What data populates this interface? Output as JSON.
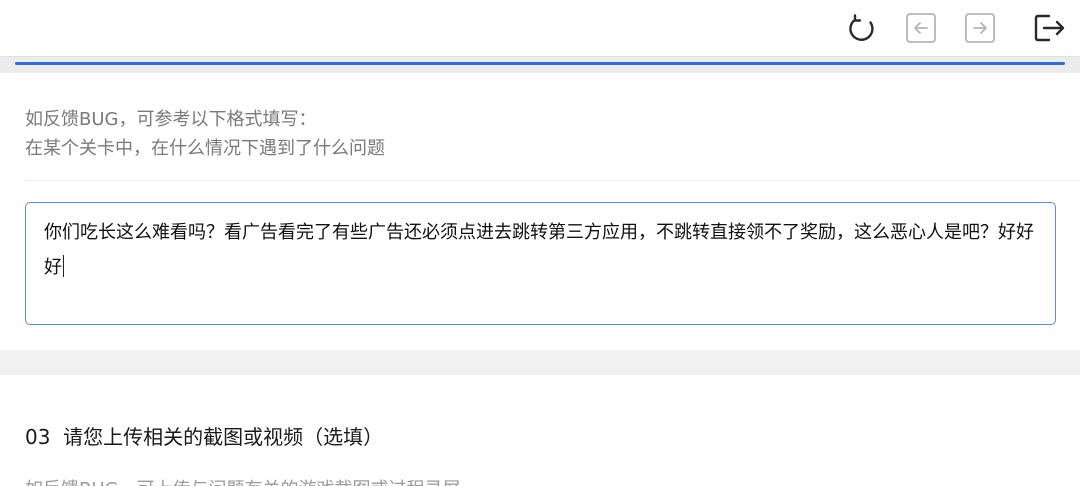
{
  "toolbar": {
    "refresh_icon": "refresh-icon",
    "back_icon": "arrow-left-icon",
    "forward_icon": "arrow-right-icon",
    "exit_icon": "logout-icon"
  },
  "progress": {
    "value": 1.0,
    "color": "#2f6fd9"
  },
  "feedback_hint": {
    "line1": "如反馈BUG，可参考以下格式填写：",
    "line2": "在某个关卡中，在什么情况下遇到了什么问题"
  },
  "feedback_input": {
    "value": "你们吃长这么难看吗？看广告看完了有些广告还必须点进去跳转第三方应用，不跳转直接领不了奖励，这么恶心人是吧？好好好"
  },
  "section3": {
    "number": "03",
    "title": "请您上传相关的截图或视频（选填）",
    "hint": "如反馈BUG，可上传与问题有关的游戏截图或过程录屏"
  }
}
